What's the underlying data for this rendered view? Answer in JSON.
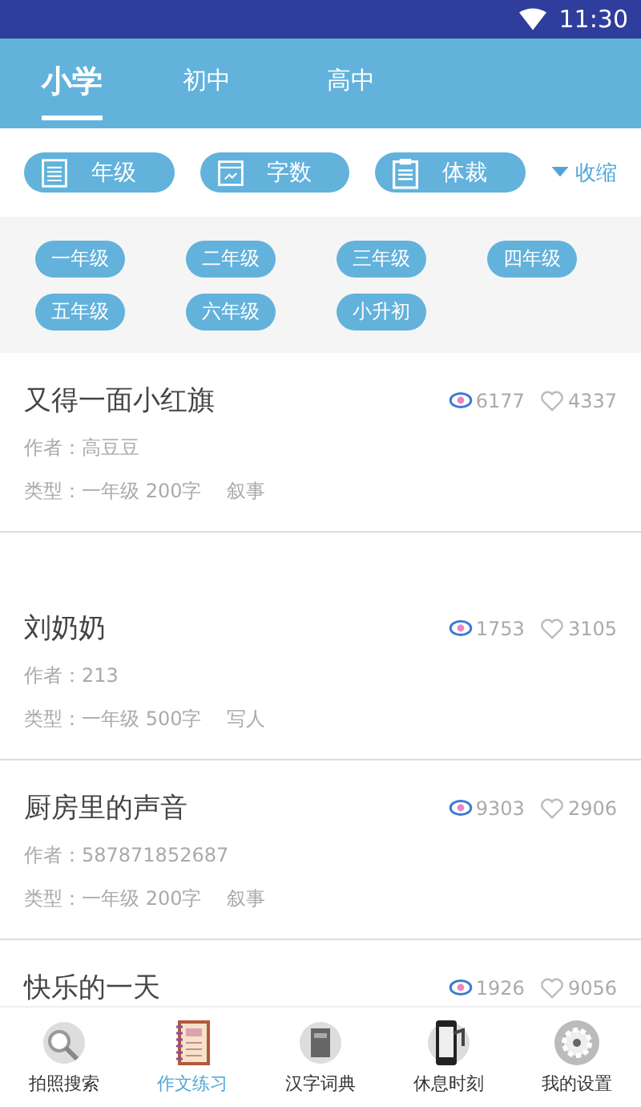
{
  "status_bar": {
    "time": "11:30"
  },
  "tabs": [
    {
      "label": "小学",
      "selected": true
    },
    {
      "label": "初中",
      "selected": false
    },
    {
      "label": "高中",
      "selected": false
    }
  ],
  "filters": [
    {
      "label": "年级",
      "kind": "grade"
    },
    {
      "label": "字数",
      "kind": "count"
    },
    {
      "label": "体裁",
      "kind": "genre"
    }
  ],
  "collapse": {
    "label": "收缩"
  },
  "grades": [
    "一年级",
    "二年级",
    "三年级",
    "四年级",
    "五年级",
    "六年级",
    "小升初"
  ],
  "essays": [
    {
      "title": "又得一面小红旗",
      "views": "6177",
      "likes": "4337",
      "author": "作者：高豆豆",
      "type": "类型：一年级 200字",
      "genre": "叙事"
    },
    {
      "title": "刘奶奶",
      "views": "1753",
      "likes": "3105",
      "author": "作者：213",
      "type": "类型：一年级 500字",
      "genre": "写人"
    },
    {
      "title": "厨房里的声音",
      "views": "9303",
      "likes": "2906",
      "author": "作者：587871852687",
      "type": "类型：一年级 200字",
      "genre": "叙事"
    },
    {
      "title": "快乐的一天",
      "views": "1926",
      "likes": "9056"
    }
  ],
  "nav": [
    {
      "label": "拍照搜索",
      "kind": "search",
      "selected": false
    },
    {
      "label": "作文练习",
      "kind": "notebook",
      "selected": true
    },
    {
      "label": "汉字词典",
      "kind": "book",
      "selected": false
    },
    {
      "label": "休息时刻",
      "kind": "phone",
      "selected": false
    },
    {
      "label": "我的设置",
      "kind": "gear",
      "selected": false
    }
  ]
}
